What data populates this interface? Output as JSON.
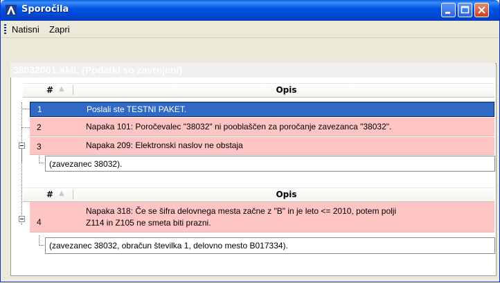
{
  "window": {
    "title": "Sporočila"
  },
  "menu": {
    "items": [
      "Natisni",
      "Zapri"
    ]
  },
  "grid": {
    "caption": "38032001.XML (Podatki so zavrnjeni)",
    "col_num": "#",
    "col_desc": "Opis",
    "rows": [
      {
        "num": "1",
        "desc": "Poslali ste TESTNI PAKET."
      },
      {
        "num": "2",
        "desc": "Napaka 101: Poročevalec \"38032\" ni pooblaščen za poročanje zavezanca \"38032\"."
      },
      {
        "num": "3",
        "desc": "Napaka 209: Elektronski naslov ne obstaja"
      }
    ],
    "detail_1": "(zavezanec 38032).",
    "group2_rows": [
      {
        "num": "4",
        "desc_line1": "Napaka 318: Če se šifra delovnega mesta začne z \"B\"  in je leto <= 2010, potem polji",
        "desc_line2": "Z114 in Z105 ne smeta biti prazni."
      }
    ],
    "detail_2": "(zavezanec 38032, obračun številka 1, delovno mesto B017334)."
  }
}
